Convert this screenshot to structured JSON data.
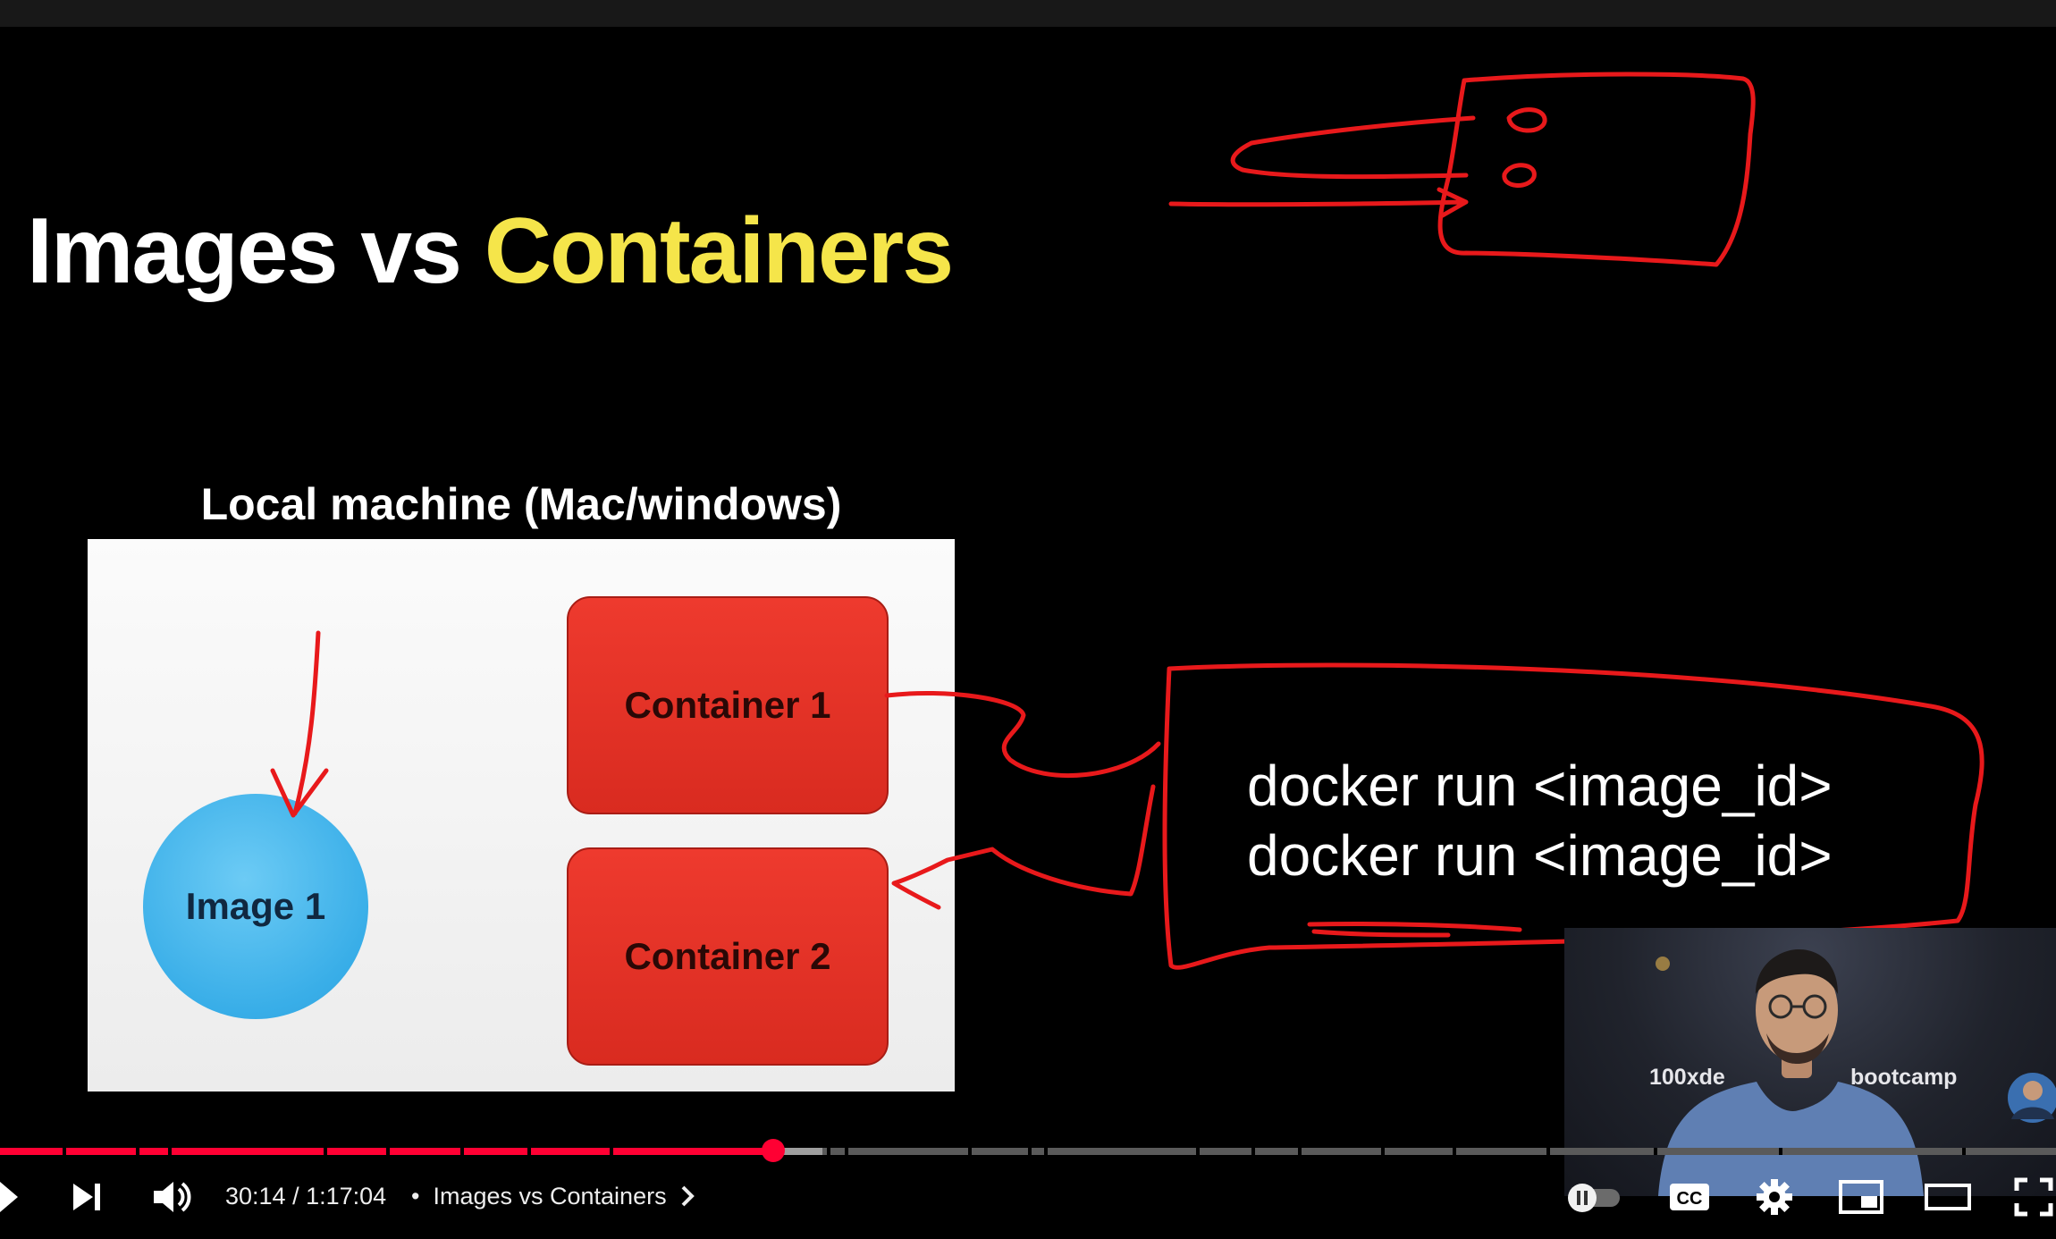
{
  "slide": {
    "title_main": "Images vs ",
    "title_accent": "Containers",
    "panel_label": "Local machine (Mac/windows)",
    "image_label": "Image 1",
    "container1_label": "Container 1",
    "container2_label": "Container 2",
    "command_line_1": "docker run <image_id>",
    "command_line_2": "docker run <image_id>"
  },
  "presenter_overlay": {
    "banner_left": "100xde",
    "banner_right": "bootcamp"
  },
  "player": {
    "current_time": "30:14",
    "duration": "1:17:04",
    "time_separator": " / ",
    "chapter_bullet": "•",
    "chapter_title": "Images vs Containers",
    "progress_fraction": 0.376,
    "buffered_fraction": 0.4,
    "cc_label": "CC",
    "autoplay_on": false,
    "icons": [
      "play-icon",
      "next-icon",
      "volume-icon",
      "chevron-right-icon",
      "autoplay-toggle-icon",
      "captions-icon",
      "settings-gear-icon",
      "miniplayer-icon",
      "theater-mode-icon",
      "fullscreen-icon"
    ],
    "colors": {
      "progress": "#ff0033",
      "scrubber": "#ff0033",
      "annotation_ink": "#e8191b",
      "title_accent": "#f5e54a"
    }
  }
}
